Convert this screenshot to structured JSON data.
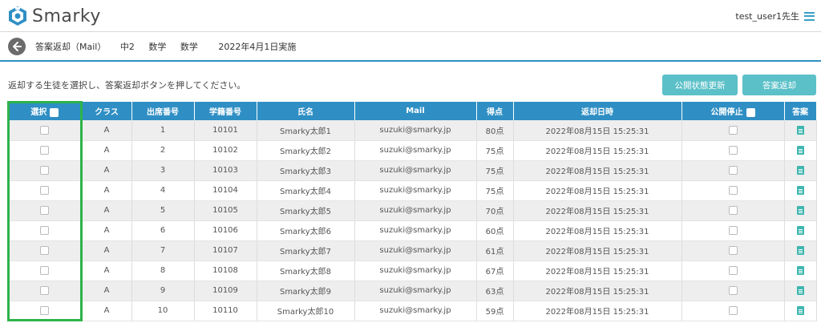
{
  "app": {
    "name": "Smarky",
    "user_label": "test_user1先生"
  },
  "breadcrumb": {
    "title": "答案返却（Mail）",
    "grade": "中2",
    "subject1": "数学",
    "subject2": "数学",
    "date": "2022年4月1日実施"
  },
  "instruction": "返却する生徒を選択し、答案返却ボタンを押してください。",
  "buttons": {
    "update_status": "公開状態更新",
    "return_answers": "答案返却"
  },
  "table": {
    "headers": [
      "選択",
      "クラス",
      "出席番号",
      "学籍番号",
      "氏名",
      "Mail",
      "得点",
      "返却日時",
      "公開停止",
      "答案"
    ],
    "rows": [
      {
        "class": "A",
        "attendance": "1",
        "student_id": "10101",
        "name": "Smarky太郎1",
        "mail": "suzuki@smarky.jp",
        "score": "80点",
        "returned": "2022年08月15日 15:25:31"
      },
      {
        "class": "A",
        "attendance": "2",
        "student_id": "10102",
        "name": "Smarky太郎2",
        "mail": "suzuki@smarky.jp",
        "score": "75点",
        "returned": "2022年08月15日 15:25:31"
      },
      {
        "class": "A",
        "attendance": "3",
        "student_id": "10103",
        "name": "Smarky太郎3",
        "mail": "suzuki@smarky.jp",
        "score": "75点",
        "returned": "2022年08月15日 15:25:31"
      },
      {
        "class": "A",
        "attendance": "4",
        "student_id": "10104",
        "name": "Smarky太郎4",
        "mail": "suzuki@smarky.jp",
        "score": "75点",
        "returned": "2022年08月15日 15:25:31"
      },
      {
        "class": "A",
        "attendance": "5",
        "student_id": "10105",
        "name": "Smarky太郎5",
        "mail": "suzuki@smarky.jp",
        "score": "70点",
        "returned": "2022年08月15日 15:25:31"
      },
      {
        "class": "A",
        "attendance": "6",
        "student_id": "10106",
        "name": "Smarky太郎6",
        "mail": "suzuki@smarky.jp",
        "score": "60点",
        "returned": "2022年08月15日 15:25:31"
      },
      {
        "class": "A",
        "attendance": "7",
        "student_id": "10107",
        "name": "Smarky太郎7",
        "mail": "suzuki@smarky.jp",
        "score": "61点",
        "returned": "2022年08月15日 15:25:31"
      },
      {
        "class": "A",
        "attendance": "8",
        "student_id": "10108",
        "name": "Smarky太郎8",
        "mail": "suzuki@smarky.jp",
        "score": "67点",
        "returned": "2022年08月15日 15:25:31"
      },
      {
        "class": "A",
        "attendance": "9",
        "student_id": "10109",
        "name": "Smarky太郎9",
        "mail": "suzuki@smarky.jp",
        "score": "63点",
        "returned": "2022年08月15日 15:25:31"
      },
      {
        "class": "A",
        "attendance": "10",
        "student_id": "10110",
        "name": "Smarky太郎10",
        "mail": "suzuki@smarky.jp",
        "score": "59点",
        "returned": "2022年08月15日 15:25:31"
      }
    ]
  },
  "colors": {
    "header_blue": "#2f8fc4",
    "button_teal": "#5bc0c8",
    "highlight_green": "#2db34a",
    "doc_icon": "#3fb6b0"
  },
  "icons": {
    "logo": "smarky-logo-icon",
    "menu": "hamburger-icon",
    "back": "back-arrow-icon",
    "answer": "document-icon"
  }
}
